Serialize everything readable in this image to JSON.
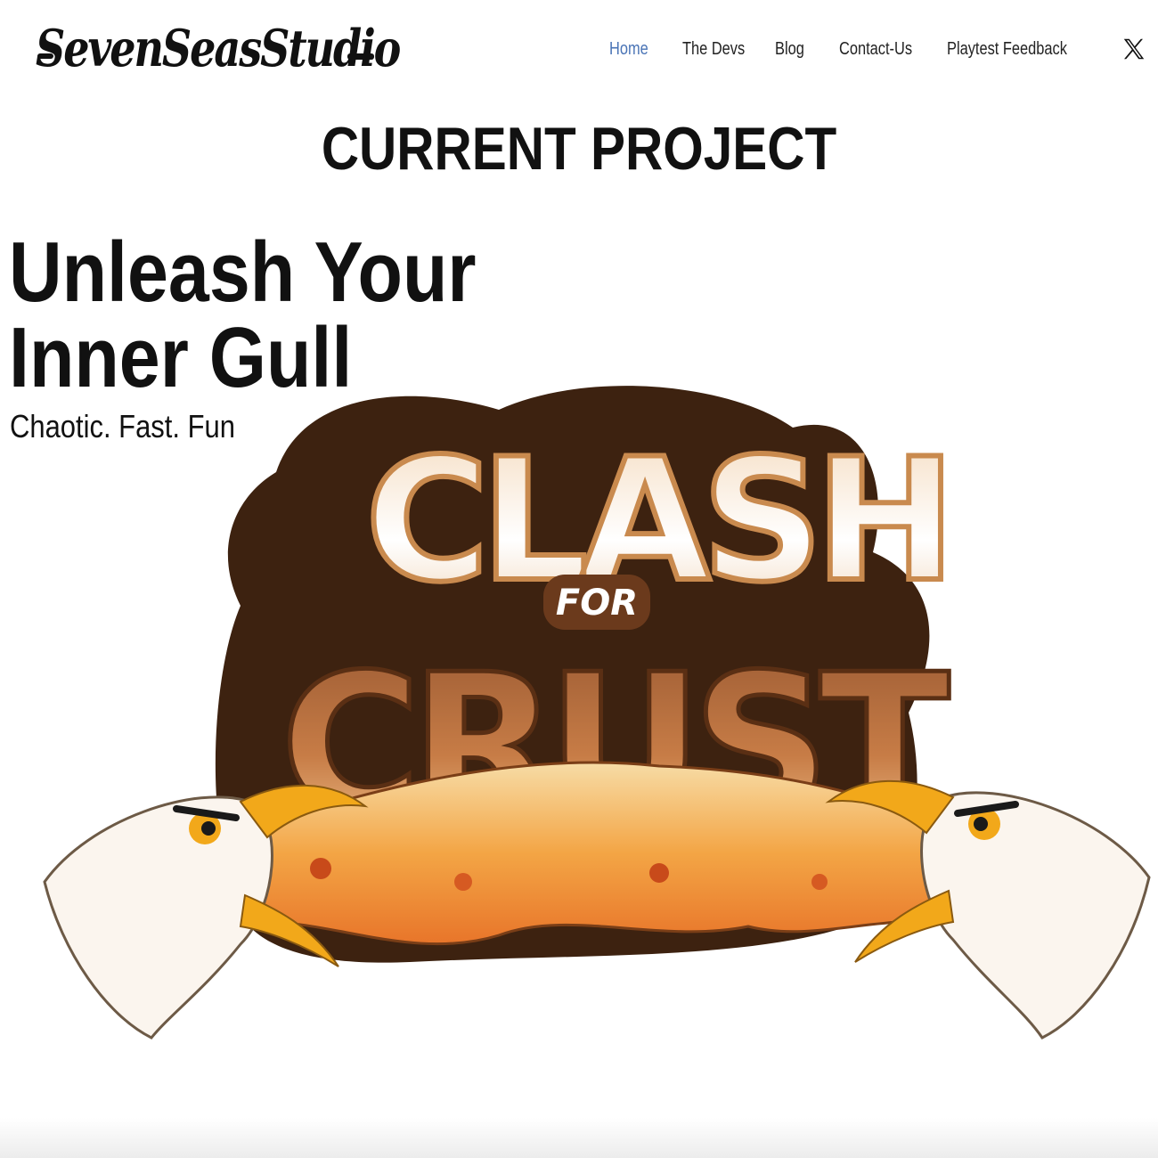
{
  "brand": {
    "logo_text": "SevenSeasStudio"
  },
  "nav": {
    "items": [
      {
        "label": "Home",
        "active": true
      },
      {
        "label": "The Devs",
        "active": false
      },
      {
        "label": "Blog",
        "active": false
      },
      {
        "label": "Contact-Us",
        "active": false
      },
      {
        "label": "Playtest Feedback",
        "active": false
      }
    ],
    "social_icon": "x-logo-icon"
  },
  "section": {
    "title": "CURRENT PROJECT"
  },
  "hero": {
    "title_line1": "Unleash Your",
    "title_line2": "Inner Gull",
    "subtitle": "Chaotic. Fast. Fun"
  },
  "game_logo": {
    "word1": "CLASH",
    "word2": "FOR",
    "word3": "CRUST"
  },
  "colors": {
    "nav_active": "#4a74b6",
    "text": "#111111",
    "logo_brown_dark": "#3d2210",
    "logo_brown": "#8b4a22",
    "crust_tan": "#f2c58a",
    "beak_orange": "#f2a81a"
  }
}
